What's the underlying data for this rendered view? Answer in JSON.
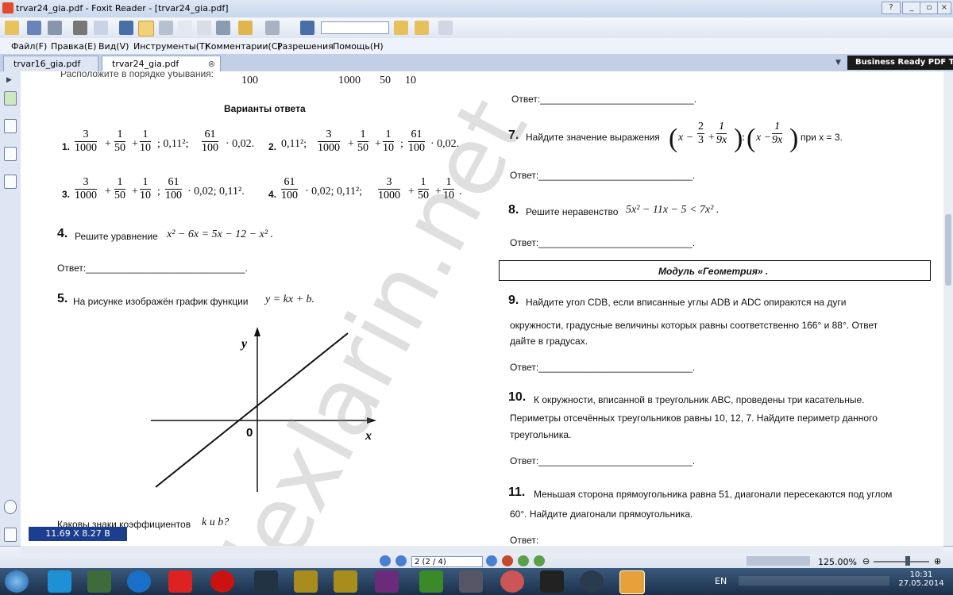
{
  "window": {
    "title": "trvar24_gia.pdf - Foxit Reader - [trvar24_gia.pdf]"
  },
  "menu": [
    "Файл(F)",
    "Правка(E)",
    "Вид(V)",
    "Инструменты(T)",
    "Комментарии(C)",
    "Разрешения",
    "Помощь(H)"
  ],
  "tabs": [
    "trvar16_gia.pdf",
    "trvar24_gia.pdf"
  ],
  "brand": "Business Ready PDF Tool",
  "doc": {
    "left": {
      "top_cut_text": "Расположите в порядке убывания:",
      "top_fracs": [
        "100",
        "1000",
        "50",
        "10"
      ],
      "options_title": "Варианты ответа",
      "options": [
        {
          "n": "1.",
          "tail": "; 0,11²;",
          "tail2": "· 0,02."
        },
        {
          "n": "2.",
          "head": "0,11²;",
          "tail2": "· 0,02."
        },
        {
          "n": "3.",
          "tail": ";",
          "tail2": "· 0,02; 0,11²."
        },
        {
          "n": "4.",
          "tail2": "· 0,02; 0,11²;"
        }
      ],
      "frac_3": {
        "n": "3",
        "d": "1000"
      },
      "frac_1_50": {
        "n": "1",
        "d": "50"
      },
      "frac_1_10": {
        "n": "1",
        "d": "10"
      },
      "frac_61": {
        "n": "61",
        "d": "100"
      },
      "q4": {
        "num": "4.",
        "text": "Решите уравнение",
        "formula": "x² − 6x = 5x − 12 − x² ."
      },
      "answer": "Ответ:______________________________.",
      "q5": {
        "num": "5.",
        "text": "На рисунке изображён график функции",
        "formula": "y = kx + b."
      },
      "graph": {
        "y": "y",
        "x": "x",
        "origin": "0"
      },
      "q5b": "Каковы знаки коэффициентов",
      "q5b_formula": "k  и  b?"
    },
    "right": {
      "answer_top": "Ответ:_____________________________.",
      "q7": {
        "num": "7.",
        "text": "Найдите значение выражения",
        "tail": "при  x = 3."
      },
      "q7_fracs": [
        {
          "n": "2",
          "d": "3"
        },
        {
          "n": "1",
          "d": "9x"
        },
        {
          "n": "1",
          "d": "9x"
        }
      ],
      "q8": {
        "num": "8.",
        "text": "Решите неравенство",
        "formula": "5x² − 11x − 5 < 7x² ."
      },
      "module": "Модуль «Геометрия» .",
      "q9": {
        "num": "9.",
        "line1": "Найдите угол CDB, если вписанные углы ADB и ADC опираются на дуги",
        "line2": "окружности, градусные величины которых равны соответственно 166° и 88°. Ответ",
        "line3": "дайте в градусах."
      },
      "q10": {
        "num": "10.",
        "line1": "К окружности, вписанной в треугольник ABC, проведены три касательные.",
        "line2": "Периметры отсечённых треугольников равны 10, 12, 7. Найдите периметр данного",
        "line3": "треугольника."
      },
      "q11": {
        "num": "11.",
        "line1": "Меньшая сторона прямоугольника равна 51, диагонали пересекаются под углом",
        "line2": "60°. Найдите диагонали прямоугольника."
      },
      "answer_bottom": "Ответ:"
    },
    "watermark": "lexlarin.net"
  },
  "page_size": "11.69 X 8.27 B",
  "status": {
    "page": "2 (2 / 4)",
    "zoom": "125.00%"
  },
  "taskbar": {
    "lang": "EN",
    "time": "10:31",
    "date": "27.05.2014"
  }
}
